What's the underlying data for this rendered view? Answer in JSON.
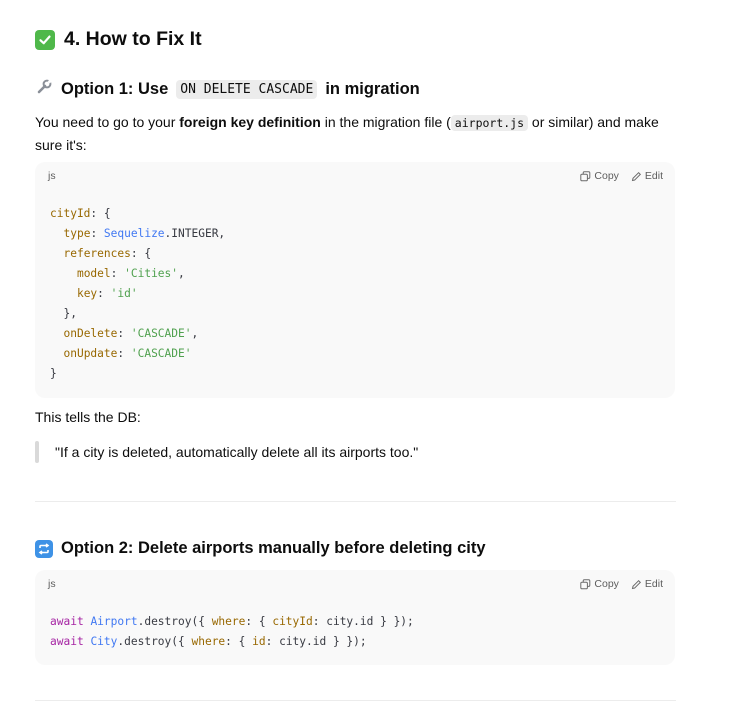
{
  "section": {
    "title": "4. How to Fix It"
  },
  "option1": {
    "heading_prefix": "Option 1: Use",
    "heading_code": "ON DELETE CASCADE",
    "heading_suffix": "in migration",
    "para_part1": "You need to go to your ",
    "para_bold": "foreign key definition",
    "para_part2": " in the migration file (",
    "para_code": "airport.js",
    "para_part3": " or similar) and make sure it's:",
    "code_lang": "js",
    "copy_label": "Copy",
    "edit_label": "Edit",
    "code": {
      "l1_prop": "cityId",
      "l1_rest": ": {",
      "l2_prop": "type",
      "l2_sep": ": ",
      "l2_id": "Sequelize",
      "l2_rest": ".INTEGER,",
      "l3_prop": "references",
      "l3_rest": ": {",
      "l4_prop": "model",
      "l4_sep": ": ",
      "l4_str": "'Cities'",
      "l4_rest": ",",
      "l5_prop": "key",
      "l5_sep": ": ",
      "l5_str": "'id'",
      "l6": "},",
      "l7_prop": "onDelete",
      "l7_sep": ": ",
      "l7_str": "'CASCADE'",
      "l7_rest": ",",
      "l8_prop": "onUpdate",
      "l8_sep": ": ",
      "l8_str": "'CASCADE'",
      "l9": "}"
    },
    "after_text": "This tells the DB:",
    "quote": "\"If a city is deleted, automatically delete all its airports too.\""
  },
  "option2": {
    "heading": "Option 2: Delete airports manually before deleting city",
    "code_lang": "js",
    "copy_label": "Copy",
    "edit_label": "Edit",
    "code": {
      "a_kw": "await",
      "a_id": "Airport",
      "a_method": ".destroy({ ",
      "a_where": "where",
      "a_mid": ": { ",
      "a_prop": "cityId",
      "a_rest": ": city.id } });",
      "b_kw": "await",
      "b_id": "City",
      "b_method": ".destroy({ ",
      "b_where": "where",
      "b_mid": ": { ",
      "b_prop": "id",
      "b_rest": ": city.id } });"
    }
  },
  "icons": {
    "check": "check-mark-button-icon",
    "wrench": "wrench-icon",
    "repeat": "repeat-button-icon",
    "copy": "copy-icon",
    "edit": "pencil-icon"
  },
  "colors": {
    "check_green": "#4fb84a",
    "repeat_blue": "#3e92e6",
    "code_bg": "#f9f9f9"
  }
}
